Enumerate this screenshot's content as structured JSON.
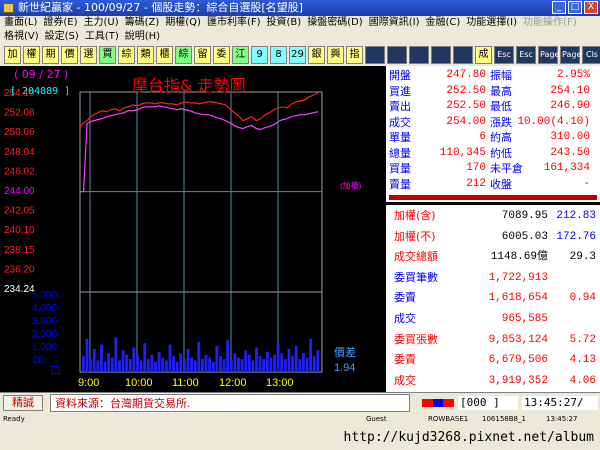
{
  "window": {
    "title": "新世紀贏家 - 100/09/27 - 個股走勢：綜合自選股[名望股]",
    "buttons": [
      "_",
      "□",
      "X"
    ]
  },
  "menus": {
    "row1": [
      "畫面(L)",
      "證券(E)",
      "主力(U)",
      "籌碼(Z)",
      "期權(Q)",
      "匯市利率(F)",
      "投資(B)",
      "操盤密碼(D)",
      "國際資訊(I)",
      "金融(C)",
      "功能選擇(I)",
      "功能操作(F)"
    ],
    "row2": [
      "格視(V)",
      "設定(S)",
      "工具(T)",
      "說明(H)"
    ]
  },
  "toolbar": [
    "加",
    "權",
    "期",
    "價",
    "選",
    "買",
    "綜",
    "類",
    "櫃",
    "綜",
    "留",
    "委",
    "江",
    "9",
    "8",
    "29",
    "銀",
    "興",
    "指",
    "",
    "",
    "",
    "",
    "",
    "成",
    "Esc",
    "Esc",
    "Page",
    "Page",
    "Cls"
  ],
  "chart": {
    "date_label": "( 09 / 27 )",
    "ref_code": "[ 204889 ]",
    "title": "摩台指& 走勢圖",
    "reference_note": "(加權)",
    "diff_label": "價差",
    "diff_value": "1.94",
    "volume_unit": "口"
  },
  "chart_data": {
    "type": "line",
    "y_ticks": [
      "254.10",
      "252.08",
      "250.06",
      "248.04",
      "246.02",
      "244.00",
      "242.05",
      "240.10",
      "238.15",
      "236.20",
      "234.24"
    ],
    "volume_ticks": [
      "5,000",
      "4,000",
      "3,000",
      "2,000",
      "1,000",
      "10"
    ],
    "x_ticks": [
      "9:00",
      "10:00",
      "11:00",
      "12:00",
      "13:00"
    ],
    "ylim": [
      234.24,
      254.1
    ],
    "reference_price": 244.0,
    "series": [
      {
        "name": "摩台指",
        "color": "#ff2020",
        "x": [
          0,
          4,
          8,
          12,
          16,
          20,
          25,
          30,
          35,
          40,
          45,
          50,
          55,
          60,
          65,
          70,
          75,
          80,
          85,
          90,
          95,
          100,
          105,
          110,
          115,
          120,
          125,
          130,
          135,
          140,
          145,
          150,
          155,
          160,
          165,
          170,
          175,
          180,
          185,
          190,
          195,
          200,
          205,
          210,
          215,
          220,
          225,
          230,
          235,
          240,
          245,
          250,
          255,
          260,
          265,
          270
        ],
        "values": [
          250.6,
          251.0,
          251.2,
          251.6,
          251.8,
          252.0,
          252.2,
          252.1,
          252.3,
          252.4,
          252.2,
          252.5,
          252.6,
          252.8,
          252.7,
          252.9,
          253.0,
          253.0,
          252.9,
          253.0,
          253.0,
          252.9,
          252.9,
          252.8,
          253.0,
          253.1,
          253.0,
          253.0,
          252.9,
          253.0,
          253.1,
          253.1,
          253.0,
          252.9,
          252.8,
          252.4,
          252.0,
          251.7,
          251.2,
          251.4,
          251.6,
          251.2,
          251.4,
          251.8,
          252.0,
          252.3,
          252.5,
          252.6,
          252.5,
          252.9,
          253.1,
          253.2,
          253.3,
          253.6,
          253.8,
          254.0
        ]
      },
      {
        "name": "加權",
        "color": "#ff40ff",
        "x": [
          0,
          4,
          8,
          12,
          16,
          20,
          25,
          30,
          35,
          40,
          45,
          50,
          55,
          60,
          65,
          70,
          75,
          80,
          85,
          90,
          95,
          100,
          105,
          110,
          115,
          120,
          125,
          130,
          135,
          140,
          145,
          150,
          155,
          160,
          165,
          170,
          175,
          180,
          185,
          190,
          195,
          200,
          205,
          210,
          215,
          220,
          225,
          230,
          235,
          240,
          245,
          250,
          255,
          260,
          265,
          270
        ],
        "values": [
          244.0,
          244.0,
          250.9,
          251.1,
          251.2,
          251.3,
          251.4,
          251.6,
          251.7,
          251.8,
          251.9,
          252.0,
          252.2,
          252.2,
          252.3,
          252.5,
          252.6,
          252.6,
          252.6,
          252.7,
          252.6,
          252.5,
          252.4,
          252.3,
          252.4,
          252.3,
          252.2,
          252.0,
          251.9,
          251.8,
          251.8,
          251.7,
          251.5,
          251.4,
          251.2,
          251.0,
          250.7,
          250.5,
          250.4,
          250.6,
          250.7,
          250.4,
          250.3,
          250.5,
          250.6,
          250.8,
          251.1,
          251.3,
          251.4,
          251.6,
          251.7,
          251.8,
          251.8,
          251.9,
          252.0,
          252.1
        ]
      }
    ],
    "volume": [
      1100,
      2300,
      900,
      1600,
      800,
      1900,
      700,
      1300,
      1000,
      2400,
      800,
      1500,
      1200,
      900,
      1700,
      1100,
      800,
      2000,
      900,
      1200,
      700,
      1400,
      1000,
      800,
      1900,
      1100,
      700,
      1300,
      900,
      1600,
      1000,
      800,
      2100,
      900,
      1200,
      1000,
      700,
      1800,
      1100,
      900,
      2200,
      800,
      1300,
      1000,
      900,
      1500,
      1200,
      800,
      1700,
      1100,
      900,
      1400,
      1000,
      1200,
      2000,
      1300,
      900,
      1600,
      1100,
      1800,
      900,
      1300,
      1000,
      2300,
      1100,
      1500
    ]
  },
  "info": {
    "rows": [
      {
        "l1": "開盤",
        "v1": "247.80",
        "l2": "振幅",
        "v2": "2.95%"
      },
      {
        "l1": "買進",
        "v1": "252.50",
        "l2": "最高",
        "v2": "254.10"
      },
      {
        "l1": "賣出",
        "v1": "252.50",
        "l2": "最低",
        "v2": "246.90"
      },
      {
        "l1": "成交",
        "v1": "254.00",
        "l2": "漲跌",
        "v2": "10.00(4.10)"
      },
      {
        "l1": "單量",
        "v1": "6",
        "l2": "約高",
        "v2": "310.00"
      },
      {
        "l1": "總量",
        "v1": "110,345",
        "l2": "約低",
        "v2": "243.50"
      },
      {
        "l1": "買量",
        "v1": "170",
        "l2": "未平倉",
        "v2": "161,334"
      },
      {
        "l1": "賣量",
        "v1": "212",
        "l2": "收盤",
        "v2": "-"
      }
    ]
  },
  "lower": {
    "rows": [
      {
        "label": "加權(含)",
        "value": "7089.95",
        "extra": "212.83",
        "lc": "red",
        "vc": "black",
        "xc": "blue"
      },
      {
        "label": "加權(不)",
        "value": "6005.03",
        "extra": "172.76",
        "lc": "red",
        "vc": "black",
        "xc": "blue"
      },
      {
        "label": "成交總額",
        "value": "1148.69億",
        "extra": "29.3",
        "lc": "red",
        "vc": "black",
        "xc": "black"
      },
      {
        "label": "委買筆數",
        "value": "1,722,913",
        "extra": "",
        "lc": "blue",
        "vc": "red",
        "xc": "red"
      },
      {
        "label": "委賣",
        "value": "1,618,654",
        "extra": "0.94",
        "lc": "blue",
        "vc": "red",
        "xc": "red"
      },
      {
        "label": "成交",
        "value": "965,585",
        "extra": "",
        "lc": "blue",
        "vc": "red",
        "xc": "red"
      },
      {
        "label": "委買張數",
        "value": "9,853,124",
        "extra": "5.72",
        "lc": "red",
        "vc": "red",
        "xc": "red"
      },
      {
        "label": "委賣",
        "value": "6,679,506",
        "extra": "4.13",
        "lc": "red",
        "vc": "red",
        "xc": "red"
      },
      {
        "label": "成交",
        "value": "3,919,352",
        "extra": "4.06",
        "lc": "red",
        "vc": "red",
        "xc": "red"
      }
    ]
  },
  "status": {
    "button": "精誠",
    "source": "資料來源：台灣期貨交易所.",
    "code": "[000 ]",
    "time": "13:45:27/"
  },
  "winstatus": {
    "ready": "Ready",
    "guest": "Guest",
    "rowbase": "ROWBASE1",
    "ip": "106158B8_1",
    "time": "13:45:27"
  },
  "watermark": "http://kujd3268.pixnet.net/album"
}
